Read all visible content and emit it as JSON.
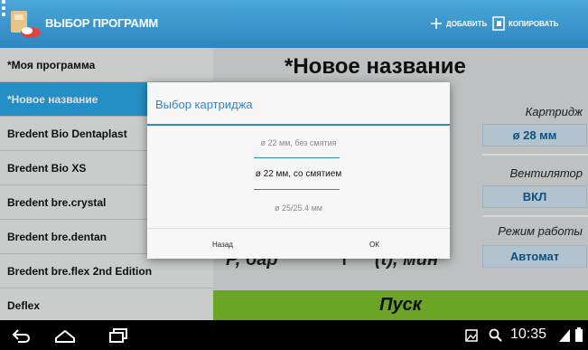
{
  "actionbar": {
    "title": "ВЫБОР ПРОГРАММ",
    "add_label": "ДОБАВИТЬ",
    "copy_label": "КОПИРОВАТЬ",
    "color": "#3a95cc"
  },
  "programs": [
    {
      "label": "*Моя программа"
    },
    {
      "label": "*Новое название"
    },
    {
      "label": "Bredent Bio Dentaplast"
    },
    {
      "label": "Bredent Bio XS"
    },
    {
      "label": "Bredent bre.crystal"
    },
    {
      "label": "Bredent bre.dentan"
    },
    {
      "label": "Bredent bre.flex 2nd Edition"
    },
    {
      "label": "Deflex"
    }
  ],
  "selected_program_index": 1,
  "program_title": "*Новое название",
  "settings": {
    "cartridge_label": "Картридж",
    "cartridge_value": "ø 28 мм",
    "fan_label": "Вентилятор",
    "fan_value": "ВКЛ",
    "mode_label": "Режим работы",
    "mode_value": "Автомат"
  },
  "pressure_label": "P, бар",
  "time_label": "(t), мин",
  "start_label": "Пуск",
  "dialog": {
    "title": "Выбор картриджа",
    "options": [
      "ø 22 мм, без смятия",
      "ø 22 мм, со смятием",
      "ø 25/25.4 мм"
    ],
    "selected_index": 1,
    "back_label": "Назад",
    "ok_label": "ОК"
  },
  "statusbar": {
    "time": "10:35"
  }
}
